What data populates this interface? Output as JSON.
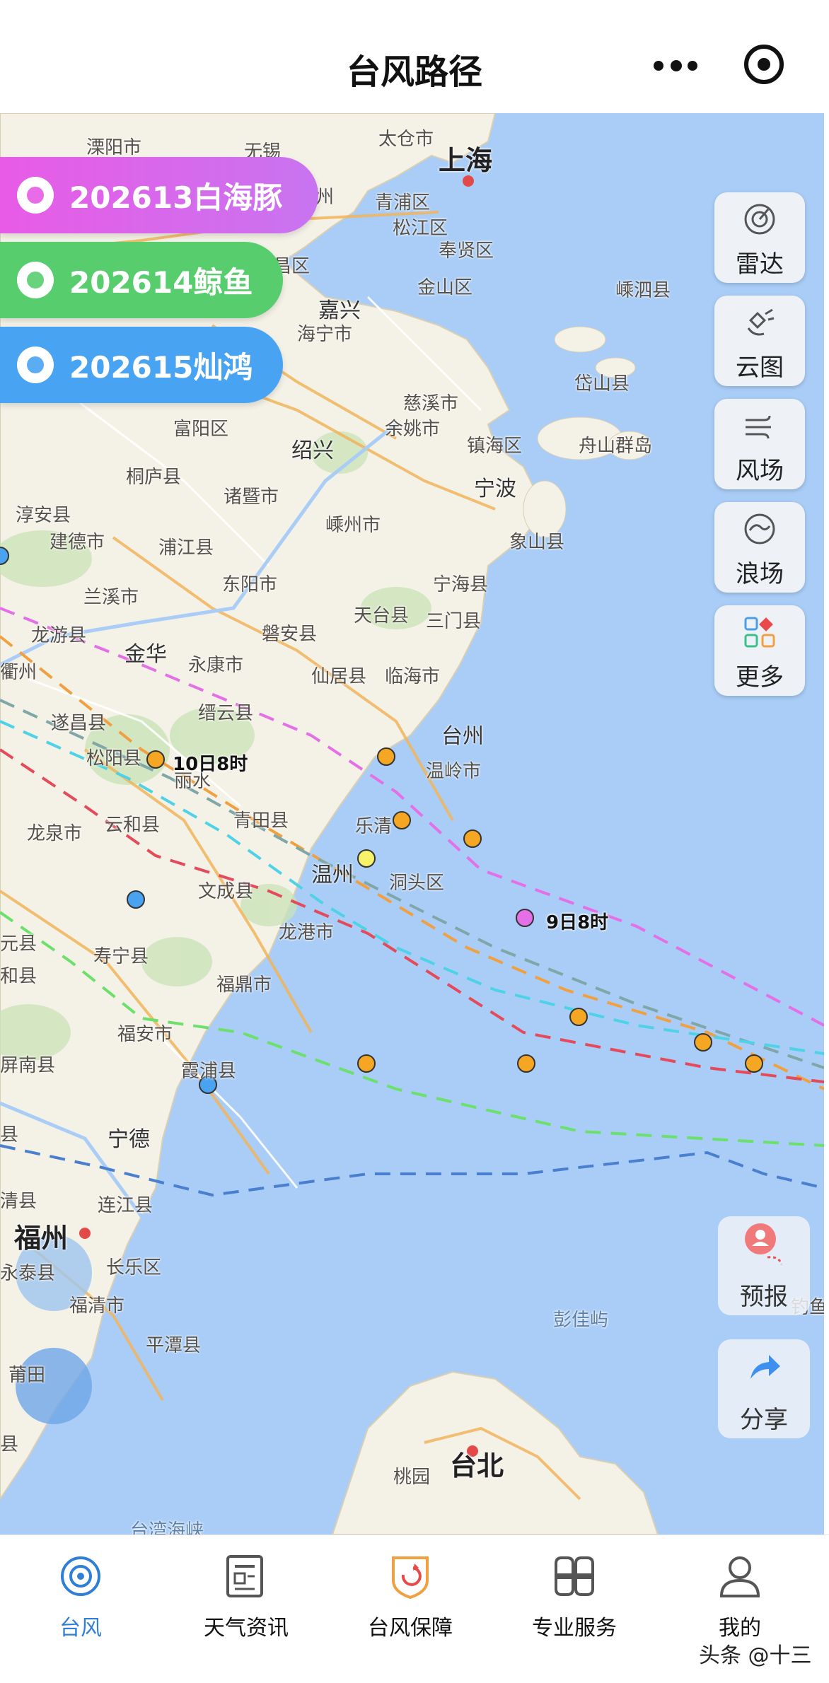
{
  "header": {
    "title": "台风路径"
  },
  "typhoons": [
    {
      "label": "202613白海豚",
      "color": "#d660e6"
    },
    {
      "label": "202614鲸鱼",
      "color": "#5bcf6c"
    },
    {
      "label": "202615灿鸿",
      "color": "#4aa3f0"
    }
  ],
  "tools": [
    {
      "label": "雷达",
      "icon": "radar-icon"
    },
    {
      "label": "云图",
      "icon": "satellite-icon"
    },
    {
      "label": "风场",
      "icon": "wind-icon"
    },
    {
      "label": "浪场",
      "icon": "wave-icon"
    },
    {
      "label": "更多",
      "icon": "more-grid-icon"
    }
  ],
  "float_buttons": {
    "forecast": "预报",
    "share": "分享"
  },
  "map_labels": {
    "shanghai": "上海",
    "wuxi": "无锡",
    "taicang": "太仓市",
    "liyang": "溧阳市",
    "qingpu": "青浦区",
    "songjiang": "松江区",
    "fengxian": "奉贤区",
    "jinshan": "金山区",
    "jiaxing": "嘉兴",
    "haining": "海宁市",
    "shengsi": "嵊泗县",
    "daishan": "岱山县",
    "cixi": "慈溪市",
    "yuyao": "余姚市",
    "zhenhai": "镇海区",
    "zhoushan": "舟山群岛",
    "shaoxing": "绍兴",
    "ningbo": "宁波",
    "fuyang": "富阳区",
    "tonglu": "桐庐县",
    "zhuji": "诸暨市",
    "shengzhou": "嵊州市",
    "xiangshan": "象山县",
    "chunan": "淳安县",
    "jiande": "建德市",
    "pujiang": "浦江县",
    "dongyang": "东阳市",
    "ninghai": "宁海县",
    "lanxi": "兰溪市",
    "tiantai": "天台县",
    "sanmen": "三门县",
    "longyou": "龙游县",
    "jinhua": "金华",
    "yongkang": "永康市",
    "panan": "磐安县",
    "xianju": "仙居县",
    "linhai": "临海市",
    "quzhou": "衢州",
    "suichang": "遂昌县",
    "jinyun": "缙云县",
    "taizhou": "台州",
    "songyang": "松阳县",
    "lishui": "丽水",
    "wenling": "温岭市",
    "longquan": "龙泉市",
    "yunhe": "云和县",
    "qingtian": "青田县",
    "yueqing": "乐清",
    "wenzhou": "温州",
    "dongtou": "洞头区",
    "wencheng": "文成县",
    "longgang": "龙港市",
    "qingyuan": "元县",
    "shouning": "寿宁县",
    "zhenghe": "和县",
    "fuding": "福鼎市",
    "fuan": "福安市",
    "pingnan": "屏南县",
    "xiapu": "霞浦县",
    "ningde": "宁德",
    "gutian": "县",
    "minqing": "清县",
    "lianjiang": "连江县",
    "fuzhou": "福州",
    "yongtai": "永泰县",
    "changle": "长乐区",
    "fuqing": "福清市",
    "pingtan": "平潭县",
    "putian": "莆田",
    "xianyou": "县",
    "pengjia": "彭佳屿",
    "taipei": "台北",
    "taoyuan": "桃园",
    "strait": "台湾海峡",
    "diaoyu": "钓鱼",
    "wuxian": "無州",
    "huzhou": "州",
    "anji": "昌区"
  },
  "time_labels": {
    "oct10": "10日8时",
    "sep9": "9日8时"
  },
  "tabs": [
    {
      "label": "台风",
      "icon": "typhoon-icon",
      "active": true
    },
    {
      "label": "天气资讯",
      "icon": "news-icon",
      "active": false
    },
    {
      "label": "台风保障",
      "icon": "shield-icon",
      "active": false
    },
    {
      "label": "专业服务",
      "icon": "grid-icon",
      "active": false
    },
    {
      "label": "我的",
      "icon": "user-icon",
      "active": false
    }
  ],
  "watermark": "头条 @十三"
}
